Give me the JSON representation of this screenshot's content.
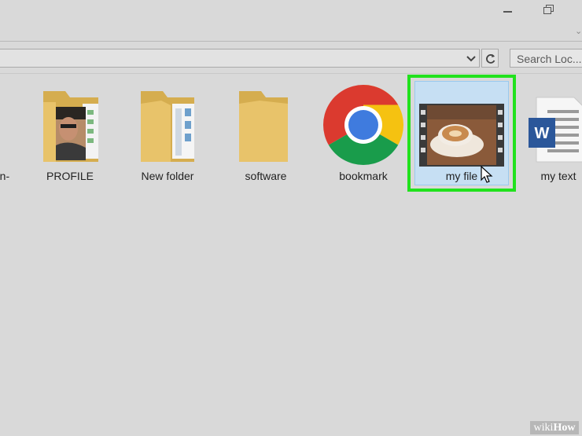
{
  "window": {
    "minimize_icon": "minimize-icon",
    "restore_icon": "restore-icon",
    "ribbon_toggle_icon": "chevron-down-icon"
  },
  "addressbar": {
    "dropdown_icon": "chevron-down-icon",
    "refresh_icon": "refresh-icon"
  },
  "search": {
    "placeholder": "Search Loc..."
  },
  "files": [
    {
      "label": "en-",
      "type": "partial"
    },
    {
      "label": "PROFILE",
      "type": "folder-photo"
    },
    {
      "label": "New folder",
      "type": "folder-docs"
    },
    {
      "label": "software",
      "type": "folder"
    },
    {
      "label": "bookmark",
      "type": "chrome-shortcut"
    },
    {
      "label": "my file",
      "type": "video",
      "selected": true
    },
    {
      "label": "my text",
      "type": "word-document"
    }
  ],
  "colors": {
    "background": "#d9d9d9",
    "selection_highlight": "#21e21d",
    "selection_fill": "#c6dff3",
    "folder": "#e8c36a"
  },
  "watermark": {
    "prefix": "wiki",
    "brand": "How"
  }
}
